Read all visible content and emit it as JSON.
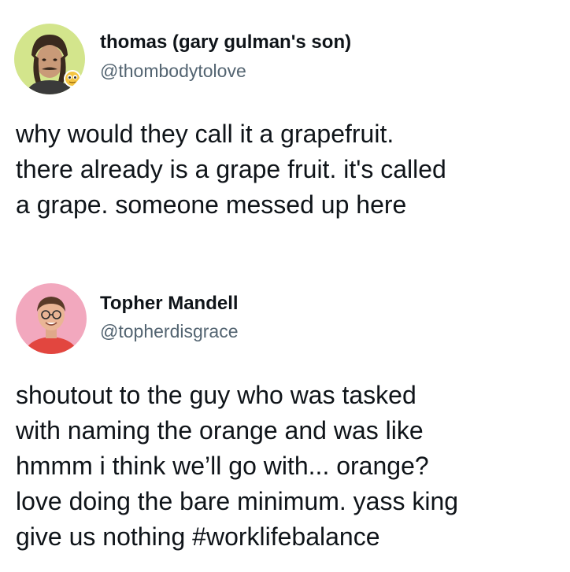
{
  "tweets": [
    {
      "display_name": "thomas (gary gulman's son)",
      "handle": "@thombodytolove",
      "avatar_icon": "user-avatar-thomas",
      "text_lines": [
        "why would they call it a grapefruit.",
        "there already is a grape fruit. it's called",
        "a grape. someone messed up here"
      ]
    },
    {
      "display_name": "Topher Mandell",
      "handle": "@topherdisgrace",
      "avatar_icon": "user-avatar-topher",
      "text_lines": [
        "shoutout to the guy who was tasked",
        "with naming the orange and was like",
        "hmmm i think we’ll go with... orange?",
        "love doing the bare minimum. yass king",
        "give us nothing #worklifebalance"
      ]
    }
  ],
  "colors": {
    "text": "#0f1419",
    "secondary_text": "#536471",
    "background": "#ffffff",
    "avatar1_bg": "#d3e58c",
    "avatar2_bg": "#f2a8be"
  }
}
